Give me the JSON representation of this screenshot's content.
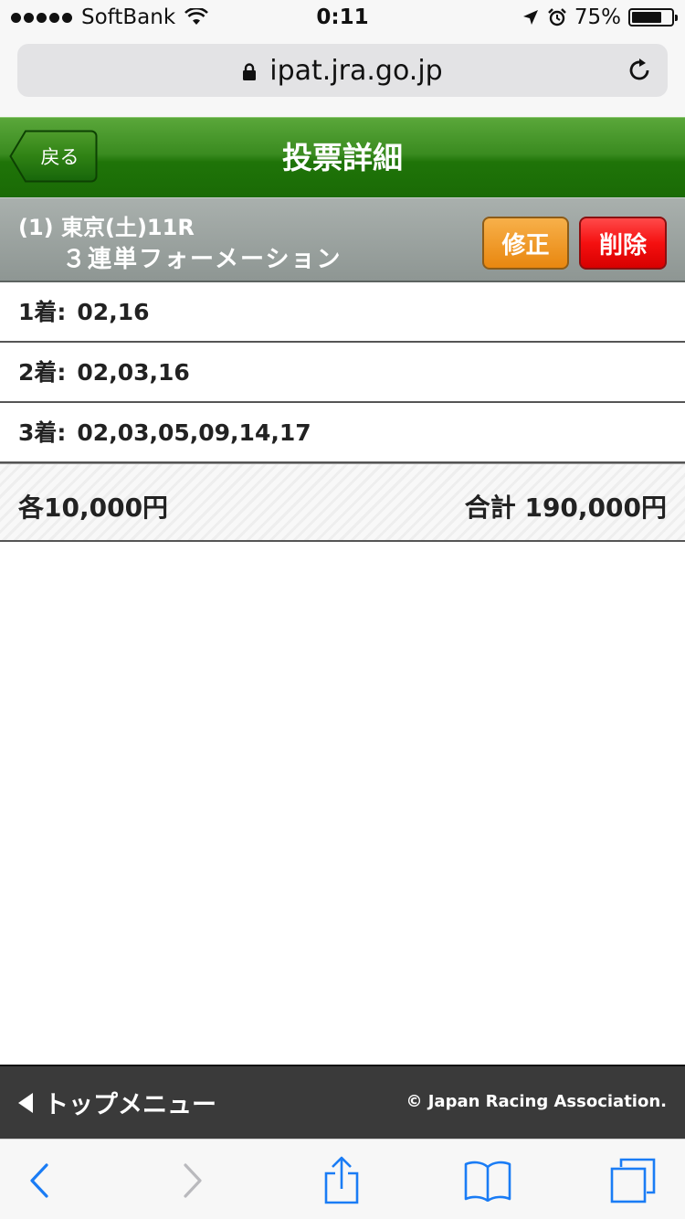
{
  "status_bar": {
    "carrier": "SoftBank",
    "time": "0:11",
    "battery_text": "75%",
    "battery_level": 0.75
  },
  "browser": {
    "url": "ipat.jra.go.jp"
  },
  "header": {
    "back_label": "戻る",
    "title": "投票詳細"
  },
  "race": {
    "line1": "(1) 東京(土)11R",
    "line2": "３連単フォーメーション",
    "edit_label": "修正",
    "delete_label": "削除"
  },
  "selections": [
    {
      "label": "1着:",
      "value": "02,16"
    },
    {
      "label": "2着:",
      "value": "02,03,16"
    },
    {
      "label": "3着:",
      "value": "02,03,05,09,14,17"
    }
  ],
  "totals": {
    "each": "各10,000円",
    "total": "合計 190,000円"
  },
  "footer": {
    "menu_label": "トップメニュー",
    "copyright": "© Japan Racing Association."
  },
  "colors": {
    "header_green": "#2a7f12",
    "edit_orange": "#ef9a22",
    "delete_red": "#f21010",
    "ios_blue": "#1a7cf5"
  }
}
